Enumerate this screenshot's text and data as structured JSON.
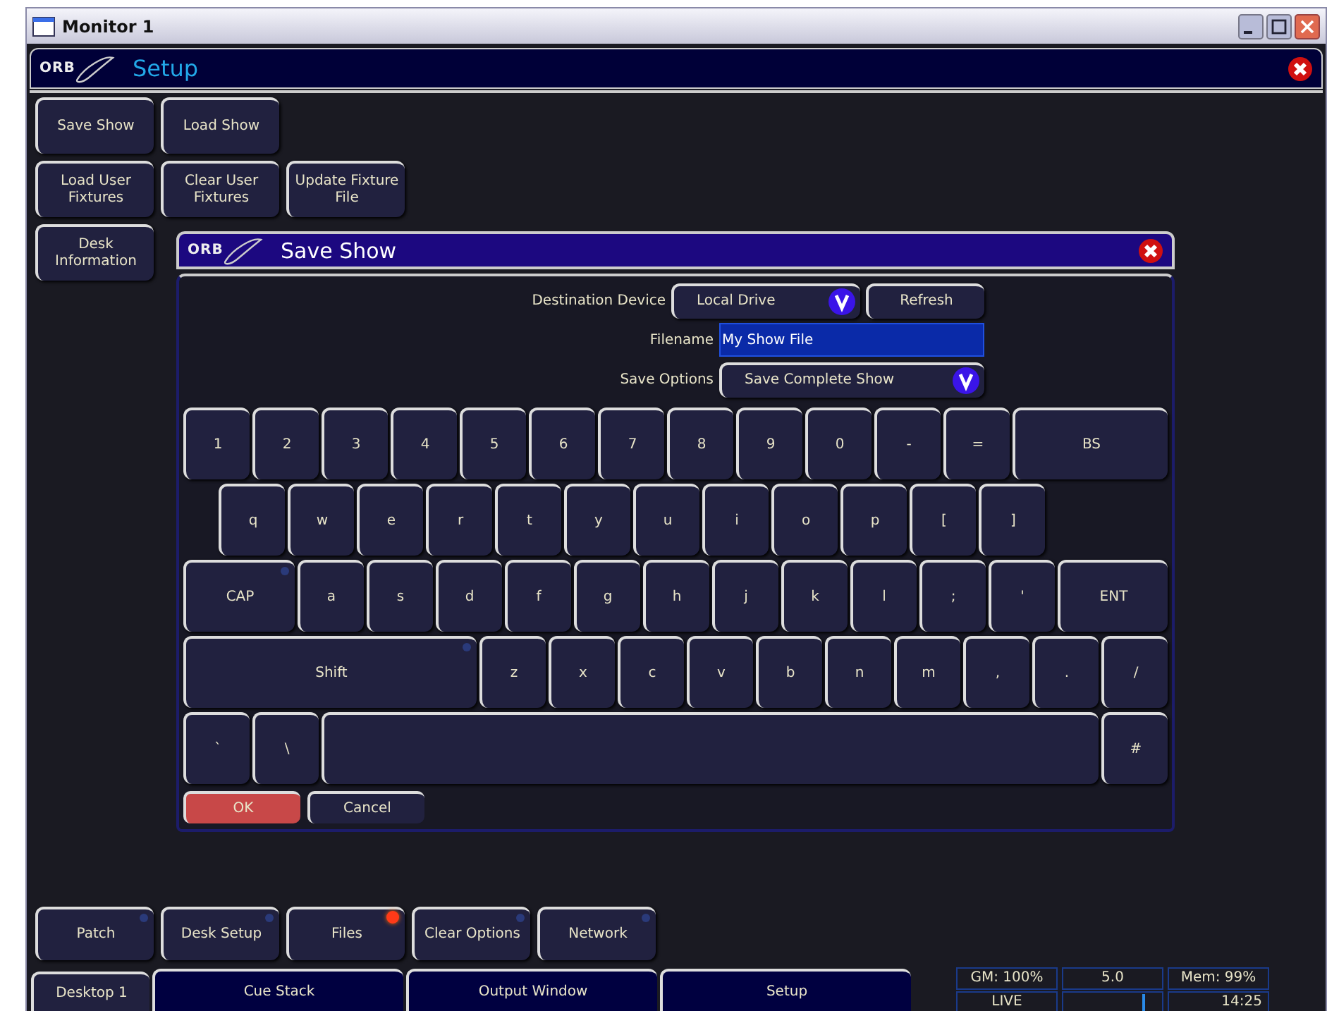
{
  "window": {
    "title": "Monitor 1"
  },
  "panel": {
    "logo": "ORB",
    "title": "Setup"
  },
  "setup_buttons": [
    [
      "Save Show",
      "Load Show"
    ],
    [
      "Load User Fixtures",
      "Clear User Fixtures",
      "Update Fixture File"
    ],
    [
      "Desk Information"
    ]
  ],
  "dialog": {
    "logo": "ORB",
    "title": "Save Show",
    "destination": {
      "label": "Destination Device",
      "value": "Local Drive",
      "button": "Refresh"
    },
    "filename": {
      "label": "Filename",
      "value": "My Show File"
    },
    "save_options": {
      "label": "Save Options",
      "value": "Save Complete Show"
    },
    "keyboard": [
      {
        "indent": false,
        "keys": [
          {
            "kind": "key",
            "label": "1"
          },
          {
            "kind": "key",
            "label": "2"
          },
          {
            "kind": "key",
            "label": "3"
          },
          {
            "kind": "key",
            "label": "4"
          },
          {
            "kind": "key",
            "label": "5"
          },
          {
            "kind": "key",
            "label": "6"
          },
          {
            "kind": "key",
            "label": "7"
          },
          {
            "kind": "key",
            "label": "8"
          },
          {
            "kind": "key",
            "label": "9"
          },
          {
            "kind": "key",
            "label": "0"
          },
          {
            "kind": "key",
            "label": "-"
          },
          {
            "kind": "key",
            "label": "="
          },
          {
            "kind": "wide",
            "label": "BS"
          }
        ]
      },
      {
        "indent": true,
        "keys": [
          {
            "kind": "key",
            "label": "q"
          },
          {
            "kind": "key",
            "label": "w"
          },
          {
            "kind": "key",
            "label": "e"
          },
          {
            "kind": "key",
            "label": "r"
          },
          {
            "kind": "key",
            "label": "t"
          },
          {
            "kind": "key",
            "label": "y"
          },
          {
            "kind": "key",
            "label": "u"
          },
          {
            "kind": "key",
            "label": "i"
          },
          {
            "kind": "key",
            "label": "o"
          },
          {
            "kind": "key",
            "label": "p"
          },
          {
            "kind": "key",
            "label": "["
          },
          {
            "kind": "key",
            "label": "]"
          }
        ]
      },
      {
        "indent": false,
        "keys": [
          {
            "kind": "wide",
            "label": "CAP",
            "indicator": false
          },
          {
            "kind": "key",
            "label": "a"
          },
          {
            "kind": "key",
            "label": "s"
          },
          {
            "kind": "key",
            "label": "d"
          },
          {
            "kind": "key",
            "label": "f"
          },
          {
            "kind": "key",
            "label": "g"
          },
          {
            "kind": "key",
            "label": "h"
          },
          {
            "kind": "key",
            "label": "j"
          },
          {
            "kind": "key",
            "label": "k"
          },
          {
            "kind": "key",
            "label": "l"
          },
          {
            "kind": "key",
            "label": ";"
          },
          {
            "kind": "key",
            "label": "'"
          },
          {
            "kind": "wide",
            "label": "ENT"
          }
        ]
      },
      {
        "indent": false,
        "keys": [
          {
            "kind": "wide",
            "label": "Shift",
            "indicator": false
          },
          {
            "kind": "key",
            "label": "z"
          },
          {
            "kind": "key",
            "label": "x"
          },
          {
            "kind": "key",
            "label": "c"
          },
          {
            "kind": "key",
            "label": "v"
          },
          {
            "kind": "key",
            "label": "b"
          },
          {
            "kind": "key",
            "label": "n"
          },
          {
            "kind": "key",
            "label": "m"
          },
          {
            "kind": "key",
            "label": ","
          },
          {
            "kind": "key",
            "label": "."
          },
          {
            "kind": "key",
            "label": "/"
          }
        ]
      },
      {
        "indent": false,
        "keys": [
          {
            "kind": "key",
            "label": "`"
          },
          {
            "kind": "key",
            "label": "\\"
          },
          {
            "kind": "space"
          },
          {
            "kind": "key",
            "label": "#"
          }
        ]
      }
    ],
    "buttons": [
      {
        "label": "OK",
        "kind": "primary"
      },
      {
        "label": "Cancel",
        "kind": "normal"
      }
    ]
  },
  "bottom_buttons": [
    {
      "label": "Patch",
      "indicator": false
    },
    {
      "label": "Desk Setup",
      "indicator": false
    },
    {
      "label": "Files",
      "indicator": true
    },
    {
      "label": "Clear Options",
      "indicator": false
    },
    {
      "label": "Network",
      "indicator": false
    }
  ],
  "taskbar": {
    "desktop_button": "Desktop 1",
    "windows": [
      "Cue Stack",
      "Output Window",
      "Setup"
    ]
  },
  "status": {
    "gm": "GM: 100%",
    "value": "5.0",
    "mem": "Mem: 99%",
    "mode": "LIVE",
    "time": "14:25"
  }
}
